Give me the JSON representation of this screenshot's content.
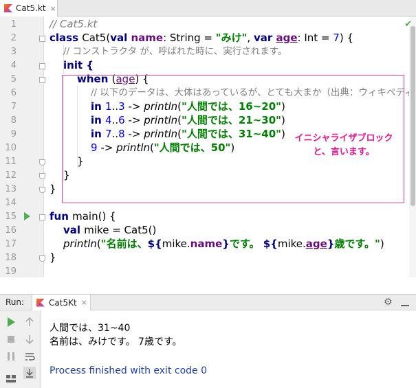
{
  "editor_tab": {
    "label": "Cat5.kt",
    "close": "×"
  },
  "code_lines": [
    "// Cat5.kt",
    "class Cat5(val name: String = \"みけ\", var age: Int = 7) {",
    "// コンストラクタ が、呼ばれた時に、実行されます。",
    "init {",
    "when (age) {",
    "// 以下のデータは、大体はあっているが、とても大まか（出典：ウィキペディア）",
    "in 1..3 -> println(\"人間では、16~20\")",
    "in 4..6 -> println(\"人間では、21~30\")",
    "in 7..8 -> println(\"人間では、31~40\")",
    "9 -> println(\"人間では、50\")",
    "}",
    "}",
    "}",
    "",
    "fun main() {",
    "val mike = Cat5()",
    "println(\"名前は、${mike.name}です。 ${mike.age}歳です。\")",
    "}",
    ""
  ],
  "line_numbers": [
    "1",
    "2",
    "3",
    "4",
    "5",
    "6",
    "7",
    "8",
    "9",
    "10",
    "11",
    "12",
    "13",
    "14",
    "15",
    "16",
    "17",
    "18",
    "19"
  ],
  "annotation": {
    "line1": "イニシャライザブロック",
    "line2": "と、言います。"
  },
  "run_panel": {
    "label": "Run:",
    "tab_label": "Cat5Kt",
    "tab_close": "×",
    "output_lines": [
      "人間では、31~40",
      "名前は、みけです。 7歳です。"
    ],
    "process": "Process finished with exit code 0"
  },
  "colors": {
    "keyword": "#000080",
    "string": "#008000",
    "number": "#0000ff",
    "property": "#660e7a",
    "comment": "#808080",
    "annotation": "#e8158c",
    "process": "#1f3fa8"
  }
}
